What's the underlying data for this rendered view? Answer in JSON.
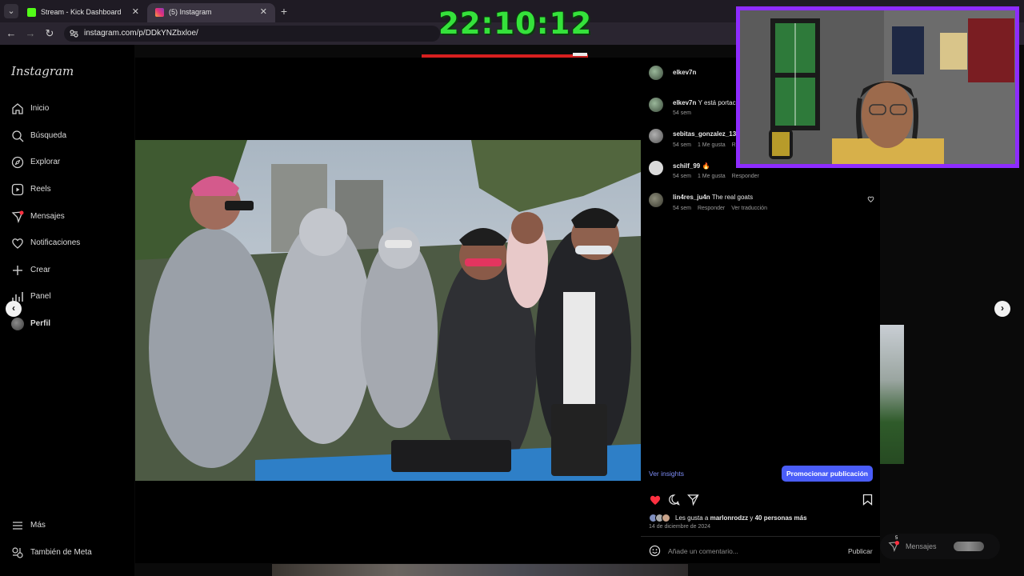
{
  "browser": {
    "tabs": [
      {
        "label": "Stream - Kick Dashboard",
        "close": "✕",
        "active": false
      },
      {
        "label": "(5) Instagram",
        "close": "✕",
        "active": true
      }
    ],
    "new_tab": "+",
    "url": "instagram.com/p/DDkYNZbxloe/"
  },
  "overlay": {
    "clock": "22:10:12"
  },
  "sidebar": {
    "logo": "Instagram",
    "items": [
      {
        "label": "Inicio",
        "icon": "home-icon"
      },
      {
        "label": "Búsqueda",
        "icon": "search-icon"
      },
      {
        "label": "Explorar",
        "icon": "compass-icon"
      },
      {
        "label": "Reels",
        "icon": "reels-icon"
      },
      {
        "label": "Mensajes",
        "icon": "messages-icon"
      },
      {
        "label": "Notificaciones",
        "icon": "heart-icon"
      },
      {
        "label": "Crear",
        "icon": "plus-icon"
      },
      {
        "label": "Panel",
        "icon": "chart-icon"
      },
      {
        "label": "Perfil",
        "icon": "avatar"
      }
    ],
    "more": "Más",
    "meta": "También de Meta"
  },
  "post": {
    "author": "elkev7n",
    "comments": [
      {
        "user": "elkev7n",
        "text": "Y está portac",
        "meta": [
          "54 sem"
        ]
      },
      {
        "user": "sebitas_gonzalez_130",
        "text": "",
        "meta": [
          "54 sem",
          "1 Me gusta",
          "R"
        ]
      },
      {
        "user": "schilf_99",
        "text": "🔥",
        "meta": [
          "54 sem",
          "1 Me gusta",
          "Responder"
        ]
      },
      {
        "user": "lin4res_ju4n",
        "text": "The real goats",
        "meta": [
          "54 sem",
          "Responder",
          "Ver traducción"
        ]
      }
    ],
    "insights": "Ver insights",
    "promote": "Promocionar publicación",
    "likes_prefix": "Les gusta a ",
    "likes_user": "marlonrodzz",
    "likes_mid": " y ",
    "likes_rest": "40 personas más",
    "date": "14 de diciembre de 2024",
    "comment_placeholder": "Añade un comentario...",
    "publish": "Publicar"
  },
  "bottom_overlay": {
    "messages": "Mensajes",
    "badge": "5"
  },
  "colors": {
    "accent_blue": "#4a5df9",
    "clock_green": "#35e23b",
    "webcam_border": "#8e2cff",
    "like_red": "#ff3040"
  }
}
